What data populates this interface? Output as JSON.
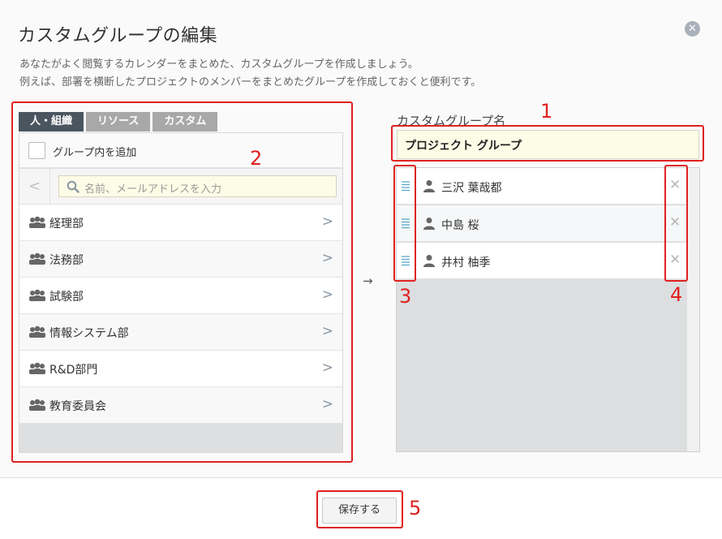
{
  "title": "カスタムグループの編集",
  "description": [
    "あなたがよく閲覧するカレンダーをまとめた、カスタムグループを作成しましょう。",
    "例えば、部署を横断したプロジェクトのメンバーをまとめたグループを作成しておくと便利です。"
  ],
  "tabs": [
    "人・組織",
    "リソース",
    "カスタム"
  ],
  "add_in_group_label": "グループ内を追加",
  "search": {
    "placeholder": "名前、メールアドレスを入力"
  },
  "org_items": [
    "経理部",
    "法務部",
    "試験部",
    "情報システム部",
    "R&D部門",
    "教育委員会"
  ],
  "right_label": "カスタムグループ名",
  "group_name": "プロジェクト グループ",
  "members": [
    "三沢 葉哉都",
    "中島 桜",
    "井村 柚季"
  ],
  "arrow": "→",
  "save_label": "保存する",
  "annotations": [
    "1",
    "2",
    "3",
    "4",
    "5"
  ],
  "colors": {
    "accent_red": "#e02020",
    "tab_active": "#4a5560",
    "tab_inactive": "#a8a8a8",
    "input_bg": "#fdfce6"
  }
}
